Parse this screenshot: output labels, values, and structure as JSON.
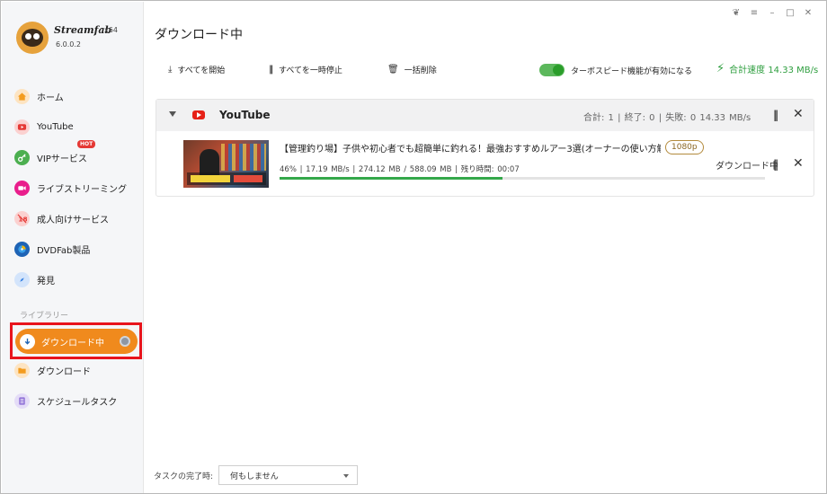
{
  "app": {
    "brand": "Streamfab",
    "arch": "x64",
    "version": "6.0.0.2"
  },
  "window_controls": [
    "skin-icon",
    "menu-icon",
    "minimize-icon",
    "maximize-icon",
    "close-icon"
  ],
  "sidebar": {
    "items": [
      {
        "label": "ホーム",
        "icon": "home-icon",
        "color": "#f39c1f"
      },
      {
        "label": "YouTube",
        "icon": "youtube-icon",
        "color": "#e53935"
      },
      {
        "label": "VIPサービス",
        "icon": "key-icon",
        "color": "#4caf50",
        "badge": "HOT"
      },
      {
        "label": "ライブストリーミング",
        "icon": "live-camera-icon",
        "color": "#e91e8c"
      },
      {
        "label": "成人向けサービス",
        "icon": "adult-restricted-icon",
        "color": "#e53935"
      },
      {
        "label": "DVDFab製品",
        "icon": "dvdfab-icon",
        "color": "#1e63b5"
      },
      {
        "label": "発見",
        "icon": "compass-icon",
        "color": "#2f7de1"
      }
    ],
    "library_label": "ライブラリー",
    "library": [
      {
        "label": "ダウンロード中",
        "icon": "download-arrow-icon",
        "color": "#f08a1d",
        "active": true
      },
      {
        "label": "ダウンロード",
        "icon": "folder-icon",
        "color": "#f39c1f"
      },
      {
        "label": "スケジュールタスク",
        "icon": "schedule-list-icon",
        "color": "#8e6fd6"
      }
    ]
  },
  "main": {
    "title": "ダウンロード中",
    "toolbar": {
      "start_all": "すべてを開始",
      "pause_all": "すべてを一時停止",
      "delete_all": "一括削除",
      "turbo_label": "ターボスピード機能が有効になる",
      "turbo_enabled": true,
      "total_speed": "合計速度 14.33 MB/s"
    },
    "group": {
      "name": "YouTube",
      "stats": "合計: 1 | 終了: 0 | 失敗: 0   14.33 MB/s",
      "item": {
        "title": "【管理釣り場】子供や初心者でも超簡単に釣れる！最強おすすめルアー3選(オーナーの使い方解説つ...",
        "quality": "1080p",
        "info": "46%  |  17.19 MB/s  |  274.12 MB / 588.09 MB  |  残り時間: 00:07",
        "progress": 0.46,
        "status": "ダウンロード中"
      }
    },
    "footer": {
      "completion_label": "タスクの完了時:",
      "completion_value": "何もしません"
    }
  }
}
